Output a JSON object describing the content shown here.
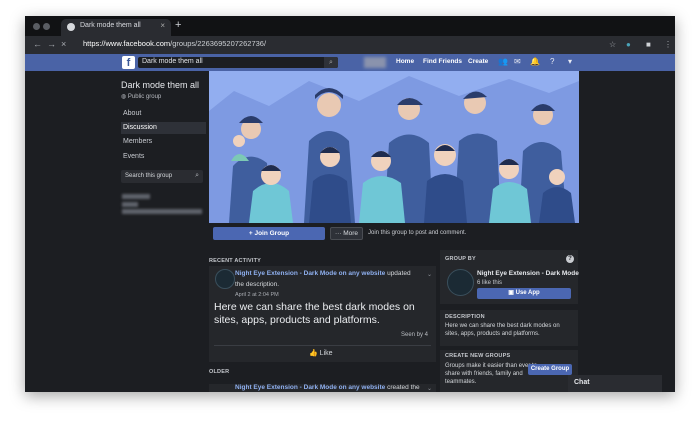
{
  "browser": {
    "tab_title": "Dark mode them all",
    "url_host": "https://www.facebook.com",
    "url_path": "/groups/2263695207262736/"
  },
  "fb": {
    "search_value": "Dark mode them all",
    "nav": {
      "home": "Home",
      "find_friends": "Find Friends",
      "create": "Create"
    }
  },
  "group": {
    "name": "Dark mode them all",
    "privacy": "Public group",
    "sidebar": [
      "About",
      "Discussion",
      "Members",
      "Events"
    ],
    "active_item": "Discussion",
    "search_placeholder": "Search this group"
  },
  "actions": {
    "join": "+ Join Group",
    "more": "··· More",
    "join_hint": "Join this group to post and comment."
  },
  "feed": {
    "recent_label": "RECENT ACTIVITY",
    "post": {
      "author": "Night Eye Extension - Dark Mode on any website",
      "action": "updated",
      "action2": "the description.",
      "date": "April 2 at 2:04 PM",
      "body": "Here we can share the best dark modes on sites, apps, products and platforms.",
      "seen": "Seen by 4",
      "like": "Like"
    },
    "older_label": "OLDER",
    "older_post": {
      "author": "Night Eye Extension - Dark Mode on any website",
      "action": "created the"
    }
  },
  "right": {
    "group_by_label": "GROUP BY",
    "owner_name": "Night Eye Extension - Dark Mode",
    "owner_likes": "6 like this",
    "use_app": "Use App",
    "description_label": "DESCRIPTION",
    "description": "Here we can share the best dark modes on sites, apps, products and platforms.",
    "create_label": "CREATE NEW GROUPS",
    "create_text": "Groups make it easier than ever to share with friends, family and teammates.",
    "create_button": "Create Group"
  },
  "chat": {
    "label": "Chat"
  }
}
